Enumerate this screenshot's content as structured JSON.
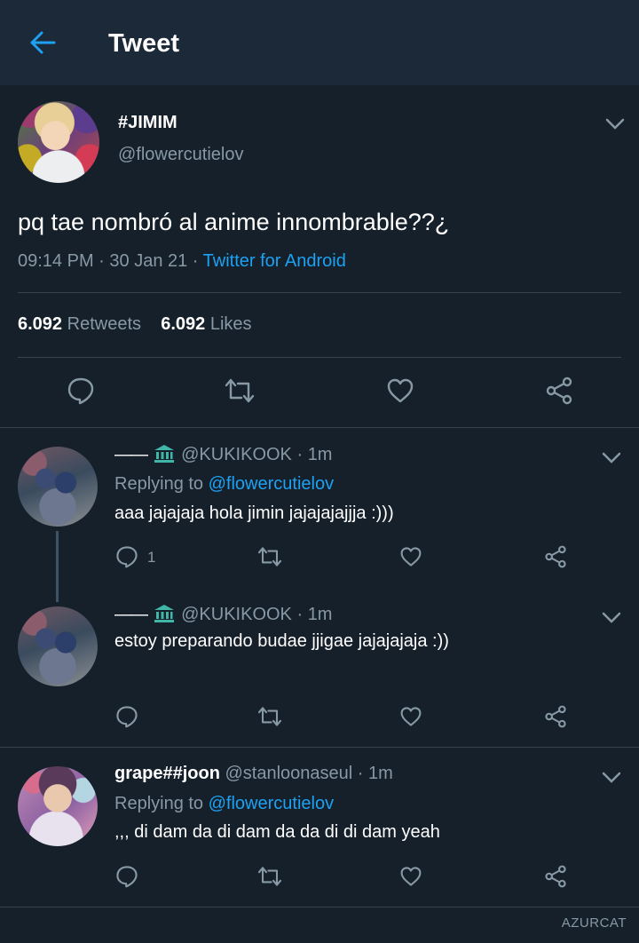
{
  "header": {
    "title": "Tweet"
  },
  "tweet": {
    "display_name": "#JIMIM",
    "handle": "@flowercutielov",
    "text": "pq tae nombró al anime innombrable??¿",
    "time": "09:14 PM",
    "date": "30 Jan 21",
    "source": "Twitter for Android",
    "retweets_count": "6.092",
    "retweets_label": "Retweets",
    "likes_count": "6.092",
    "likes_label": "Likes"
  },
  "replies": [
    {
      "name_prefix": "——",
      "handle": "@KUKIKOOK",
      "time": "1m",
      "replying_to_label": "Replying to",
      "replying_to": "@flowercutielov",
      "text": "aaa jajajaja hola jimin jajajajajjja :)))",
      "reply_count": "1"
    },
    {
      "name_prefix": "——",
      "handle": "@KUKIKOOK",
      "time": "1m",
      "text": "estoy preparando budae jjigae jajajajaja :))"
    },
    {
      "display_name": "grape##joon",
      "handle": "@stanloonaseul",
      "time": "1m",
      "replying_to_label": "Replying to",
      "replying_to": "@flowercutielov",
      "text": ",,, di dam da di dam da da di di dam yeah"
    }
  ],
  "watermark": "AZURCAT",
  "colors": {
    "background": "#15202b",
    "topbar": "#1c2938",
    "accent": "#1da1f2",
    "secondary_text": "#8899a6",
    "divider": "#38444d"
  }
}
